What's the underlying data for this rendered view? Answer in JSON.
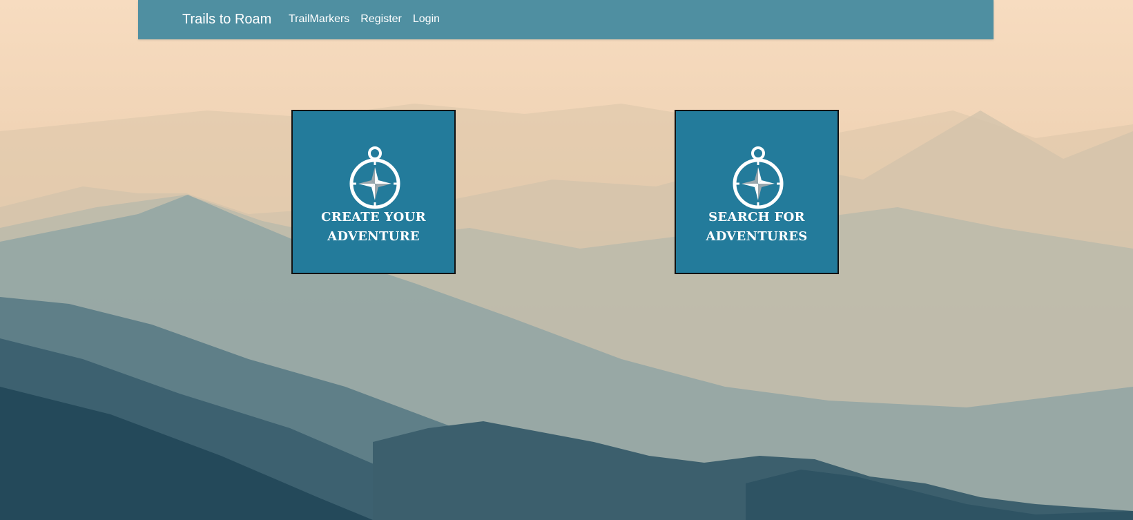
{
  "navbar": {
    "brand": "Trails to Roam",
    "links": [
      "TrailMarkers",
      "Register",
      "Login"
    ]
  },
  "cards": [
    {
      "label": "CREATE YOUR ADVENTURE",
      "icon": "compass-icon"
    },
    {
      "label": "SEARCH FOR ADVENTURES",
      "icon": "compass-icon"
    }
  ],
  "colors": {
    "navbar": "#4f8fa1",
    "card": "#237b9b",
    "text": "#ffffff"
  }
}
